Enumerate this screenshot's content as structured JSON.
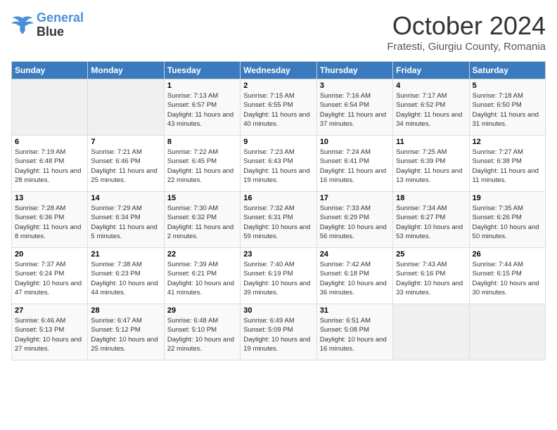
{
  "logo": {
    "line1": "General",
    "line2": "Blue"
  },
  "title": "October 2024",
  "location": "Fratesti, Giurgiu County, Romania",
  "days_of_week": [
    "Sunday",
    "Monday",
    "Tuesday",
    "Wednesday",
    "Thursday",
    "Friday",
    "Saturday"
  ],
  "weeks": [
    [
      {
        "day": "",
        "info": ""
      },
      {
        "day": "",
        "info": ""
      },
      {
        "day": "1",
        "info": "Sunrise: 7:13 AM\nSunset: 6:57 PM\nDaylight: 11 hours and 43 minutes."
      },
      {
        "day": "2",
        "info": "Sunrise: 7:15 AM\nSunset: 6:55 PM\nDaylight: 11 hours and 40 minutes."
      },
      {
        "day": "3",
        "info": "Sunrise: 7:16 AM\nSunset: 6:54 PM\nDaylight: 11 hours and 37 minutes."
      },
      {
        "day": "4",
        "info": "Sunrise: 7:17 AM\nSunset: 6:52 PM\nDaylight: 11 hours and 34 minutes."
      },
      {
        "day": "5",
        "info": "Sunrise: 7:18 AM\nSunset: 6:50 PM\nDaylight: 11 hours and 31 minutes."
      }
    ],
    [
      {
        "day": "6",
        "info": "Sunrise: 7:19 AM\nSunset: 6:48 PM\nDaylight: 11 hours and 28 minutes."
      },
      {
        "day": "7",
        "info": "Sunrise: 7:21 AM\nSunset: 6:46 PM\nDaylight: 11 hours and 25 minutes."
      },
      {
        "day": "8",
        "info": "Sunrise: 7:22 AM\nSunset: 6:45 PM\nDaylight: 11 hours and 22 minutes."
      },
      {
        "day": "9",
        "info": "Sunrise: 7:23 AM\nSunset: 6:43 PM\nDaylight: 11 hours and 19 minutes."
      },
      {
        "day": "10",
        "info": "Sunrise: 7:24 AM\nSunset: 6:41 PM\nDaylight: 11 hours and 16 minutes."
      },
      {
        "day": "11",
        "info": "Sunrise: 7:25 AM\nSunset: 6:39 PM\nDaylight: 11 hours and 13 minutes."
      },
      {
        "day": "12",
        "info": "Sunrise: 7:27 AM\nSunset: 6:38 PM\nDaylight: 11 hours and 11 minutes."
      }
    ],
    [
      {
        "day": "13",
        "info": "Sunrise: 7:28 AM\nSunset: 6:36 PM\nDaylight: 11 hours and 8 minutes."
      },
      {
        "day": "14",
        "info": "Sunrise: 7:29 AM\nSunset: 6:34 PM\nDaylight: 11 hours and 5 minutes."
      },
      {
        "day": "15",
        "info": "Sunrise: 7:30 AM\nSunset: 6:32 PM\nDaylight: 11 hours and 2 minutes."
      },
      {
        "day": "16",
        "info": "Sunrise: 7:32 AM\nSunset: 6:31 PM\nDaylight: 10 hours and 59 minutes."
      },
      {
        "day": "17",
        "info": "Sunrise: 7:33 AM\nSunset: 6:29 PM\nDaylight: 10 hours and 56 minutes."
      },
      {
        "day": "18",
        "info": "Sunrise: 7:34 AM\nSunset: 6:27 PM\nDaylight: 10 hours and 53 minutes."
      },
      {
        "day": "19",
        "info": "Sunrise: 7:35 AM\nSunset: 6:26 PM\nDaylight: 10 hours and 50 minutes."
      }
    ],
    [
      {
        "day": "20",
        "info": "Sunrise: 7:37 AM\nSunset: 6:24 PM\nDaylight: 10 hours and 47 minutes."
      },
      {
        "day": "21",
        "info": "Sunrise: 7:38 AM\nSunset: 6:23 PM\nDaylight: 10 hours and 44 minutes."
      },
      {
        "day": "22",
        "info": "Sunrise: 7:39 AM\nSunset: 6:21 PM\nDaylight: 10 hours and 41 minutes."
      },
      {
        "day": "23",
        "info": "Sunrise: 7:40 AM\nSunset: 6:19 PM\nDaylight: 10 hours and 39 minutes."
      },
      {
        "day": "24",
        "info": "Sunrise: 7:42 AM\nSunset: 6:18 PM\nDaylight: 10 hours and 36 minutes."
      },
      {
        "day": "25",
        "info": "Sunrise: 7:43 AM\nSunset: 6:16 PM\nDaylight: 10 hours and 33 minutes."
      },
      {
        "day": "26",
        "info": "Sunrise: 7:44 AM\nSunset: 6:15 PM\nDaylight: 10 hours and 30 minutes."
      }
    ],
    [
      {
        "day": "27",
        "info": "Sunrise: 6:46 AM\nSunset: 5:13 PM\nDaylight: 10 hours and 27 minutes."
      },
      {
        "day": "28",
        "info": "Sunrise: 6:47 AM\nSunset: 5:12 PM\nDaylight: 10 hours and 25 minutes."
      },
      {
        "day": "29",
        "info": "Sunrise: 6:48 AM\nSunset: 5:10 PM\nDaylight: 10 hours and 22 minutes."
      },
      {
        "day": "30",
        "info": "Sunrise: 6:49 AM\nSunset: 5:09 PM\nDaylight: 10 hours and 19 minutes."
      },
      {
        "day": "31",
        "info": "Sunrise: 6:51 AM\nSunset: 5:08 PM\nDaylight: 10 hours and 16 minutes."
      },
      {
        "day": "",
        "info": ""
      },
      {
        "day": "",
        "info": ""
      }
    ]
  ]
}
